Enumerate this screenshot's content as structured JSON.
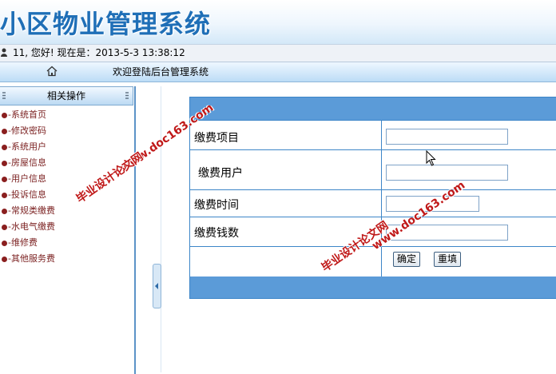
{
  "app": {
    "title": "小区物业管理系统"
  },
  "userbar": {
    "text": "11, 您好! 现在是：2013-5-3 13:38:12"
  },
  "navbar": {
    "welcome": "欢迎登陆后台管理系统"
  },
  "sidebar": {
    "header": "相关操作",
    "items": [
      {
        "label": "-系统首页"
      },
      {
        "label": "-修改密码"
      },
      {
        "label": "-系统用户"
      },
      {
        "label": "-房屋信息"
      },
      {
        "label": "-用户信息"
      },
      {
        "label": "-投诉信息"
      },
      {
        "label": "-常规类缴费"
      },
      {
        "label": "-水电气缴费"
      },
      {
        "label": "-维修费"
      },
      {
        "label": "-其他服务费"
      }
    ]
  },
  "form": {
    "fields": [
      {
        "label": "缴费项目",
        "value": ""
      },
      {
        "label": "缴费用户",
        "value": ""
      },
      {
        "label": "缴费时间",
        "value": ""
      },
      {
        "label": "缴费钱数",
        "value": ""
      }
    ],
    "confirm_label": "确定",
    "reset_label": "重填"
  },
  "watermarks": {
    "site": "www.doc163.com",
    "brand": "毕业设计论文网"
  },
  "colors": {
    "title_blue": "#1f6fb7",
    "panel_blue": "#5b9bd8",
    "menu_text": "#7a1f1f",
    "watermark_red": "#c01919"
  }
}
